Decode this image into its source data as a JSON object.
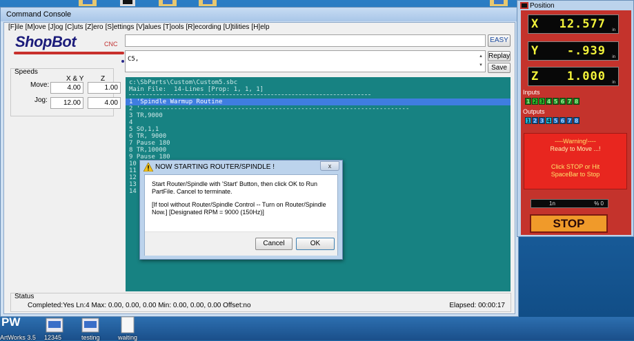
{
  "console": {
    "title": "Command Console",
    "menu": [
      "[F]ile",
      "[M]ove",
      "[J]og",
      "[C]uts",
      "[Z]ero",
      "[S]ettings",
      "[V]alues",
      "[T]ools",
      "[R]ecording",
      "[U]tilities",
      "[H]elp"
    ],
    "logo_text": "ShopBot",
    "logo_sub": "CNC",
    "buttons": {
      "easy": "EASY",
      "replay": "Replay",
      "save": "Save"
    },
    "command_text": "C5,",
    "speeds": {
      "title": "Speeds",
      "col_xy": "X & Y",
      "col_z": "Z",
      "move_label": "Move:",
      "jog_label": "Jog:",
      "move_xy": "4.00",
      "move_z": "1.00",
      "jog_xy": "12.00",
      "jog_z": "4.00"
    },
    "terminal": {
      "path": "c:\\SbParts\\Custom\\Custom5.sbc",
      "main_file": "Main File:  14-Lines [Prop: 1, 1, 1]",
      "lines": [
        "1 'Spindle Warmup Routine",
        "2 '------------------------------------------------------------------------",
        "3 TR,9000",
        "4",
        "5 SO,1,1",
        "6 TR, 9000",
        "7 Pause 180",
        "8 TR,10000",
        "9 Pause 180",
        "10",
        "11",
        "12",
        "13",
        "14"
      ]
    },
    "status": {
      "title": "Status",
      "line": "Completed:Yes Ln:4 Max: 0.00, 0.00, 0.00  Min: 0.00, 0.00, 0.00  Offset:no",
      "elapsed": "Elapsed: 00:00:17"
    }
  },
  "dialog": {
    "title": "NOW STARTING ROUTER/SPINDLE !",
    "close": "x",
    "text1": "Start Router/Spindle with 'Start' Button, then click OK to Run PartFile. Cancel to terminate.",
    "text2": "[If tool without Router/Spindle Control -- Turn on Router/Spindle Now.]  [Designated RPM = 9000 (150Hz)]",
    "cancel": "Cancel",
    "ok": "OK"
  },
  "position": {
    "title": "Position",
    "x_axis": "X",
    "x_val": "12.577",
    "y_axis": "Y",
    "y_val": "-.939",
    "z_axis": "Z",
    "z_val": "1.000",
    "unit": "in",
    "inputs_label": "Inputs",
    "inputs": [
      "1",
      "2",
      "3",
      "4",
      "5",
      "6",
      "7",
      "8"
    ],
    "outputs_label": "Outputs",
    "outputs": [
      "1",
      "2",
      "3",
      "4",
      "5",
      "6",
      "7",
      "8"
    ],
    "warning_title": "----Warning!----",
    "warning_ready": "Ready to Move ...!",
    "warning_hint": "Click STOP or Hit SpaceBar to Stop",
    "rate_left": "1n",
    "rate_right": "% 0",
    "stop": "STOP"
  },
  "desktop": {
    "icons": [
      {
        "label": "ArtWorks 3.5"
      },
      {
        "label": "12345"
      },
      {
        "label": "testing"
      },
      {
        "label": "waiting"
      }
    ]
  },
  "colors": {
    "accent_red": "#c4332c",
    "terminal": "#178282",
    "highlight": "#3f7de0",
    "dro_text": "#f3f33a"
  }
}
